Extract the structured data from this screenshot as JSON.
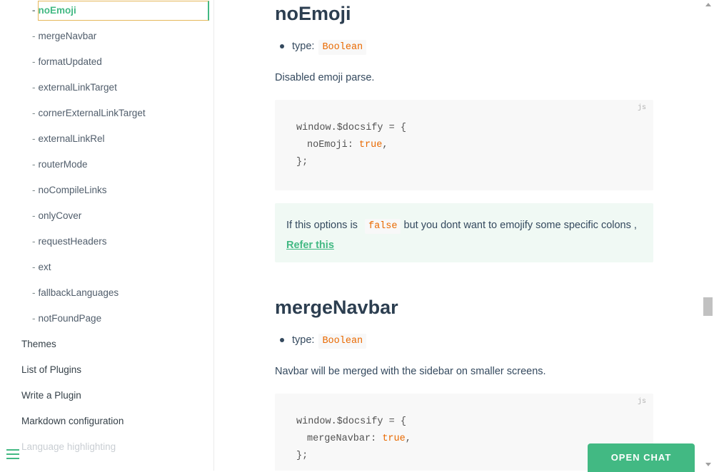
{
  "sidebar": {
    "active_item": "noEmoji",
    "sub_items": [
      "noEmoji",
      "mergeNavbar",
      "formatUpdated",
      "externalLinkTarget",
      "cornerExternalLinkTarget",
      "externalLinkRel",
      "routerMode",
      "noCompileLinks",
      "onlyCover",
      "requestHeaders",
      "ext",
      "fallbackLanguages",
      "notFoundPage"
    ],
    "dash": "-",
    "top_items": [
      "Themes",
      "List of Plugins",
      "Write a Plugin",
      "Markdown configuration",
      "Language highlighting"
    ]
  },
  "content": {
    "sections": [
      {
        "title": "noEmoji",
        "type_label": "type:",
        "type_value": "Boolean",
        "description": "Disabled emoji parse.",
        "code_lang": "js",
        "code": {
          "l1": "window.$docsify = {",
          "key": "noEmoji",
          "value": "true",
          "l3": "};"
        }
      },
      {
        "title": "mergeNavbar",
        "type_label": "type:",
        "type_value": "Boolean",
        "description": "Navbar will be merged with the sidebar on smaller screens.",
        "code_lang": "js",
        "code": {
          "l1": "window.$docsify = {",
          "key": "mergeNavbar",
          "value": "true",
          "l3": "};"
        }
      }
    ],
    "tip": {
      "before": "If this options is",
      "code": "false",
      "after": "but you dont want to emojify some specific colons ,",
      "link": "Refer this"
    }
  },
  "chat": {
    "label": "OPEN CHAT"
  },
  "colors": {
    "accent": "#42b983",
    "code_keyword": "#e96900",
    "tip_bg": "#f0f9f4"
  }
}
